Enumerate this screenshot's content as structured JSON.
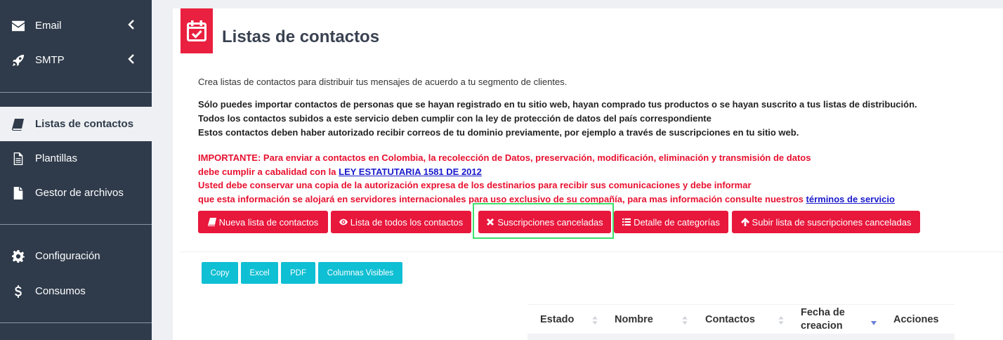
{
  "sidebar": {
    "items": [
      {
        "label": "Email",
        "icon": "envelope-icon",
        "chevron": true
      },
      {
        "label": "SMTP",
        "icon": "rocket-icon",
        "chevron": true
      },
      {
        "label": "Listas de contactos",
        "icon": "book-icon",
        "active": true
      },
      {
        "label": "Plantillas",
        "icon": "file-text-icon"
      },
      {
        "label": "Gestor de archivos",
        "icon": "file-icon"
      },
      {
        "label": "Configuración",
        "icon": "gear-icon"
      },
      {
        "label": "Consumos",
        "icon": "dollar-icon"
      }
    ]
  },
  "page": {
    "title": "Listas de contactos",
    "description": "Crea listas de contactos para distribuir tus mensajes de acuerdo a tu segmento de clientes.",
    "rules": [
      "Sólo puedes importar contactos de personas que se hayan registrado en tu sitio web, hayan comprado tus productos o se hayan suscrito a tus listas de distribución.",
      "Todos los contactos subidos a este servicio deben cumplir con la ley de protección de datos del país correspondiente",
      "Estos contactos deben haber autorizado recibir correos de tu dominio previamente, por ejemplo a través de suscripciones en tu sitio web."
    ],
    "important": {
      "line1": "IMPORTANTE: Para enviar a contactos en Colombia, la recolección de Datos, preservación, modificación, eliminación y transmisión de datos",
      "line2_prefix": "debe cumplir a cabalidad con la ",
      "law_link": "LEY ESTATUTARIA 1581 DE 2012",
      "line3": "Usted debe conservar una copia de la autorización expresa de los destinarios para recibir sus comunicaciones y debe informar",
      "line4_prefix": "que esta información se alojará en servidores internacionales para uso exclusivo de su compañía, para mas información consulte nuestros ",
      "terms_link": "términos de servicio"
    }
  },
  "actions": {
    "new_list": "Nueva lista de contactos",
    "all_contacts": "Lista de todos los contactos",
    "cancelled": "Suscripciones canceladas",
    "categories": "Detalle de categorías",
    "upload_cancelled": "Subir lista de suscripciones canceladas"
  },
  "export": {
    "copy": "Copy",
    "excel": "Excel",
    "pdf": "PDF",
    "columns": "Columnas Visibles"
  },
  "table": {
    "headers": [
      "Estado",
      "Nombre",
      "Contactos",
      "Fecha de creacion",
      "Acciones"
    ],
    "header_date_line1": "Fecha de",
    "header_date_line2": "creacion"
  },
  "colors": {
    "sidebar": "#2f3b4b",
    "accent_red": "#e8173c",
    "export_cyan": "#0fbfd3",
    "highlight": "#3de06b"
  }
}
